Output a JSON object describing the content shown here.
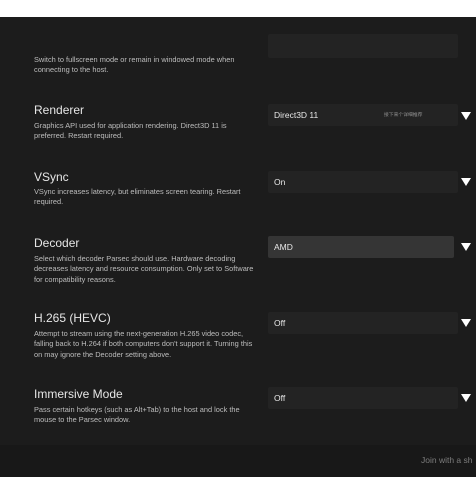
{
  "settings": [
    {
      "key": "fullscreen",
      "description": "Switch to fullscreen mode or remain in windowed mode when connecting to the host."
    },
    {
      "key": "renderer",
      "title": "Renderer",
      "description": "Graphics API used for application rendering. Direct3D 11 is preferred. Restart required.",
      "value": "Direct3D 11",
      "hint": "接下来个详细推荐"
    },
    {
      "key": "vsync",
      "title": "VSync",
      "description": "VSync increases latency, but eliminates screen tearing. Restart required.",
      "value": "On"
    },
    {
      "key": "decoder",
      "title": "Decoder",
      "description": "Select which decoder Parsec should use. Hardware decoding decreases latency and resource consumption. Only set to Software for compatibility reasons.",
      "value": "AMD"
    },
    {
      "key": "h265",
      "title": "H.265 (HEVC)",
      "description": "Attempt to stream using the next-generation H.265 video codec, falling back to H.264 if both computers don't support it. Turning this on may ignore the Decoder setting above.",
      "value": "Off"
    },
    {
      "key": "immersive",
      "title": "Immersive Mode",
      "description": "Pass certain hotkeys (such as Alt+Tab) to the host and lock the mouse to the Parsec window.",
      "value": "Off"
    }
  ],
  "footer": {
    "join_text": "Join with a sh"
  }
}
